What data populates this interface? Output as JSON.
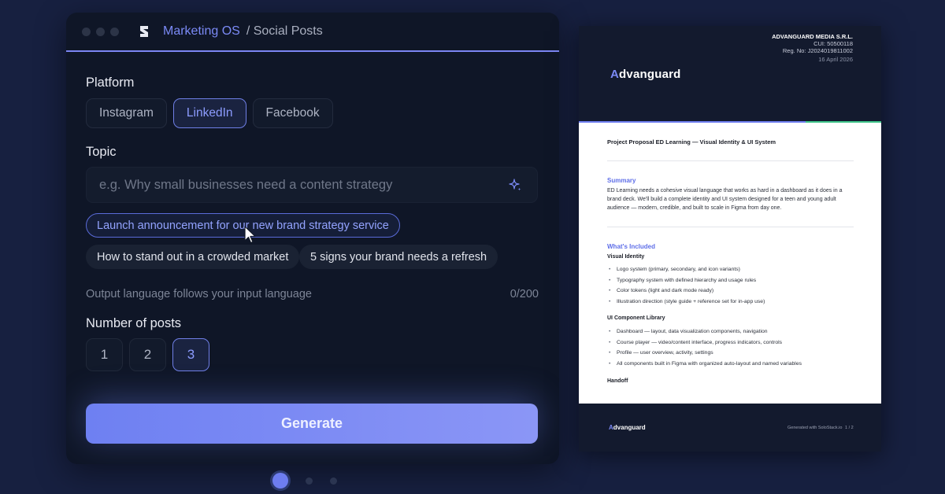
{
  "app": {
    "name": "Marketing OS",
    "breadcrumb": "/ Social Posts"
  },
  "platform": {
    "label": "Platform",
    "options": [
      "Instagram",
      "LinkedIn",
      "Facebook"
    ],
    "selected": "LinkedIn"
  },
  "topic": {
    "label": "Topic",
    "placeholder": "e.g. Why small businesses need a content strategy",
    "value": "",
    "suggestions": [
      "Launch announcement for our new brand strategy service",
      "How to stand out in a crowded market",
      "5 signs your brand needs a refresh"
    ],
    "helper": "Output language follows your input language",
    "counter": "0/200"
  },
  "posts": {
    "label": "Number of posts",
    "options": [
      "1",
      "2",
      "3"
    ],
    "selected": "3"
  },
  "generate_label": "Generate",
  "pager": {
    "count": 3,
    "active": 0
  },
  "doc": {
    "company_name": "ADVANGUARD MEDIA S.R.L.",
    "cui": "CUI: 50500118",
    "reg": "Reg. No: J2024019811002",
    "date": "16 April 2026",
    "brand_first": "A",
    "brand_rest": "dvanguard",
    "title": "Project Proposal ED Learning — Visual Identity & UI System",
    "summary_heading": "Summary",
    "summary_text": "ED Learning needs a cohesive visual language that works as hard in a dashboard as it does in a brand deck. We'll build a complete identity and UI system designed for a teen and young adult audience — modern, credible, and built to scale in Figma from day one.",
    "included_heading": "What's Included",
    "visual_identity_heading": "Visual Identity",
    "visual_identity_items": [
      "Logo system (primary, secondary, and icon variants)",
      "Typography system with defined hierarchy and usage rules",
      "Color tokens (light and dark mode ready)",
      "Illustration direction (style guide + reference set for in-app use)"
    ],
    "ui_library_heading": "UI Component Library",
    "ui_library_items": [
      "Dashboard — layout, data visualization components, navigation",
      "Course player — video/content interface, progress indicators, controls",
      "Profile — user overview, activity, settings",
      "All components built in Figma with organized auto-layout and named variables"
    ],
    "handoff_heading": "Handoff",
    "footer_generated": "Generated with SoloStack.io",
    "footer_page": "1 / 2"
  },
  "colors": {
    "background": "#172040",
    "window": "#0f1627",
    "accent": "#7b8af6",
    "success_bar": "#3fc58a"
  }
}
